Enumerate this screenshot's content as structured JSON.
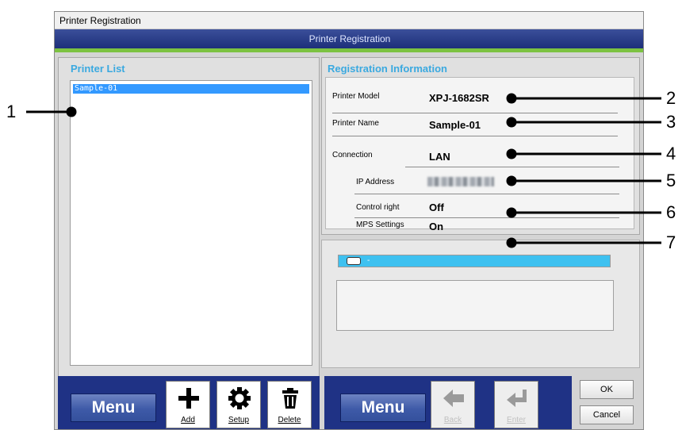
{
  "window": {
    "title": "Printer Registration",
    "banner": "Printer Registration"
  },
  "left_panel": {
    "title": "Printer List",
    "printers": [
      "Sample-01"
    ]
  },
  "registration": {
    "title": "Registration Information",
    "printer_model_label": "Printer Model",
    "printer_model": "XPJ-1682SR",
    "printer_name_label": "Printer Name",
    "printer_name": "Sample-01",
    "connection_label": "Connection",
    "connection": "LAN",
    "ip_address_label": "IP Address",
    "control_right_label": "Control right",
    "control_right": "Off",
    "mps_settings_label": "MPS Settings",
    "mps_settings": "On"
  },
  "status": {
    "text": "-"
  },
  "left_toolbar": {
    "menu_label": "Menu",
    "add_label": "Add",
    "setup_label": "Setup",
    "delete_label": "Delete"
  },
  "right_toolbar": {
    "menu_label": "Menu",
    "back_label": "Back",
    "enter_label": "Enter",
    "ok_label": "OK",
    "cancel_label": "Cancel"
  },
  "callouts": [
    "1",
    "2",
    "3",
    "4",
    "5",
    "6",
    "7"
  ],
  "colors": {
    "accent_blue": "#3aa9e0",
    "toolbar_navy": "#1f3285",
    "selection_blue": "#3399ff",
    "status_cyan": "#3ec1f0",
    "green_rule": "#7cc241"
  }
}
